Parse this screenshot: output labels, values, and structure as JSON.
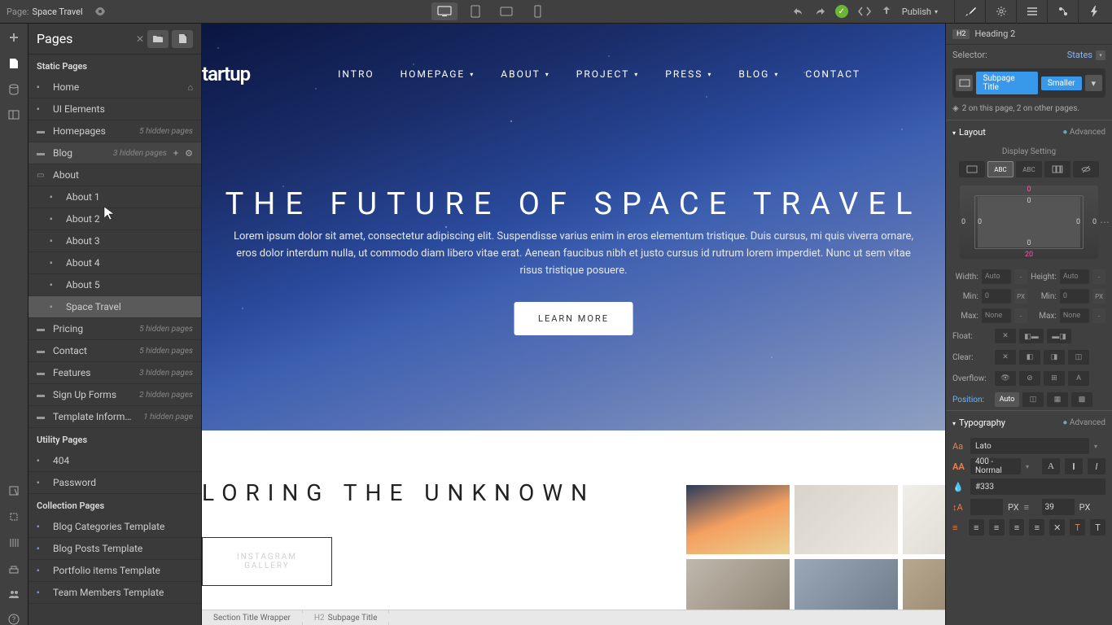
{
  "topbar": {
    "page_label": "Page:",
    "page_name": "Space Travel",
    "publish": "Publish"
  },
  "pagesPanel": {
    "title": "Pages",
    "sections": {
      "static": "Static Pages",
      "utility": "Utility Pages",
      "collection": "Collection Pages"
    },
    "items": {
      "home": "Home",
      "ui": "UI Elements",
      "homepages": "Homepages",
      "homepages_note": "5 hidden pages",
      "blog": "Blog",
      "blog_note": "3 hidden pages",
      "about": "About",
      "about1": "About 1",
      "about2": "About 2",
      "about3": "About 3",
      "about4": "About 4",
      "about5": "About 5",
      "space": "Space Travel",
      "pricing": "Pricing",
      "pricing_note": "5 hidden pages",
      "contact": "Contact",
      "contact_note": "5 hidden pages",
      "features": "Features",
      "features_note": "3 hidden pages",
      "signup": "Sign Up Forms",
      "signup_note": "2 hidden pages",
      "template": "Template Inform…",
      "template_note": "1 hidden page",
      "p404": "404",
      "password": "Password",
      "blogcat": "Blog Categories Template",
      "blogposts": "Blog Posts Template",
      "portfolio": "Portfolio items Template",
      "team": "Team Members Template"
    }
  },
  "canvas": {
    "logo": "tartup",
    "nav": {
      "intro": "INTRO",
      "homepage": "HOMEPAGE",
      "about": "ABOUT",
      "project": "PROJECT",
      "press": "PRESS",
      "blog": "BLOG",
      "contact": "CONTACT"
    },
    "hero_title": "THE FUTURE OF SPACE TRAVEL",
    "hero_text": "Lorem ipsum dolor sit amet, consectetur adipiscing elit. Suspendisse varius enim in eros elementum tristique. Duis cursus, mi quis viverra ornare, eros dolor interdum nulla, ut commodo diam libero vitae erat. Aenean faucibus nibh et justo cursus id rutrum lorem imperdiet. Nunc ut sem vitae risus tristique posuere.",
    "learn": "LEARN MORE",
    "below_title": "LORING THE UNKNOWN",
    "insta": "INSTAGRAM GALLERY"
  },
  "breadcrumb": {
    "b1": "Section Title Wrapper",
    "b2_tag": "H2",
    "b2": "Subpage Title"
  },
  "stylePanel": {
    "elem_tag": "H2",
    "elem_name": "Heading 2",
    "selector_label": "Selector:",
    "states": "States",
    "class1": "Subpage Title",
    "class2": "Smaller",
    "usage": "2 on this page, 2 on other pages.",
    "layout": {
      "header": "Layout",
      "advanced": "Advanced",
      "display": "Display Setting",
      "margin_top": "0",
      "margin_bottom": "20",
      "margin_left": "0",
      "margin_right": "0",
      "padding_top": "0",
      "padding_bottom": "0",
      "padding_left": "0",
      "padding_right": "0",
      "width_l": "Width:",
      "width_v": "Auto",
      "height_l": "Height:",
      "height_v": "Auto",
      "minw_l": "Min:",
      "minw_v": "0",
      "minh_l": "Min:",
      "minh_v": "0",
      "maxw_l": "Max:",
      "maxw_v": "None",
      "maxh_l": "Max:",
      "maxh_v": "None",
      "float_l": "Float:",
      "clear_l": "Clear:",
      "overflow_l": "Overflow:",
      "position_l": "Position:",
      "position_v": "Auto",
      "px": "PX"
    },
    "typo": {
      "header": "Typography",
      "advanced": "Advanced",
      "font": "Lato",
      "weight": "400 - Normal",
      "color": "#333",
      "size_v": "",
      "lh_v": "39"
    }
  }
}
